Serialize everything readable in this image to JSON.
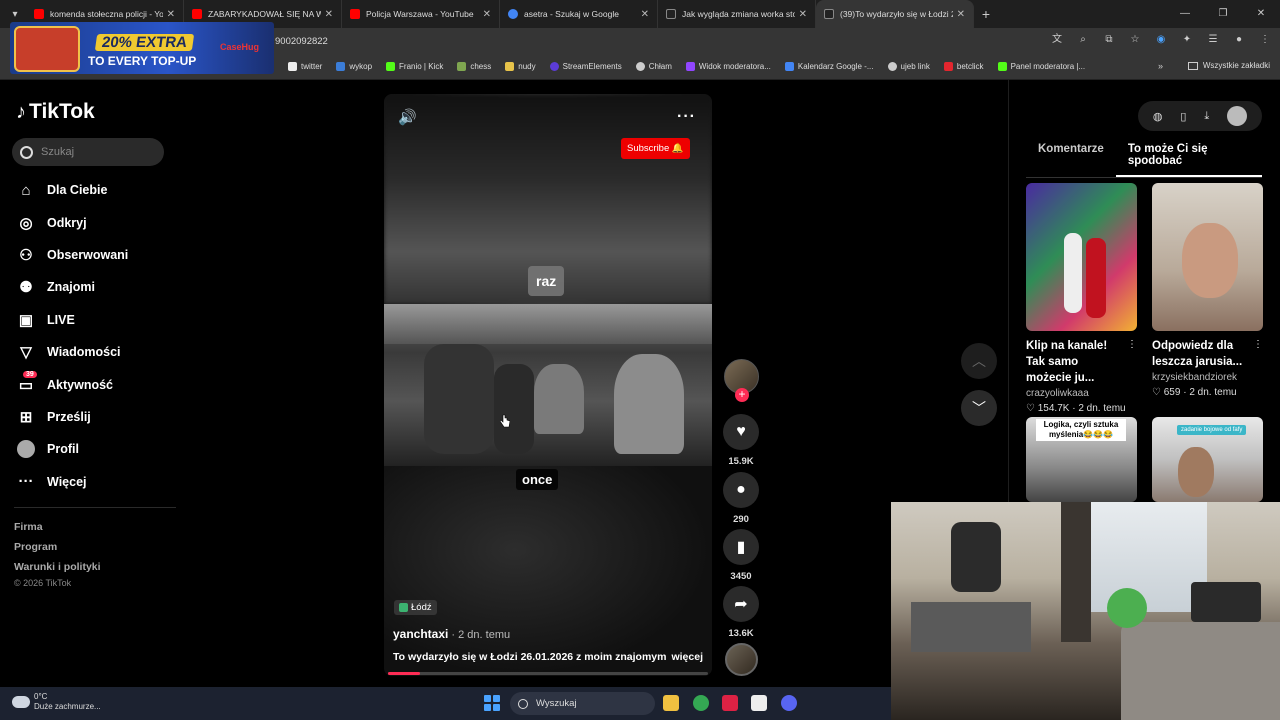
{
  "browser": {
    "tabs": [
      {
        "title": "komenda stołeczna policji - You",
        "favicon_color": "#ff0000"
      },
      {
        "title": "ZABARYKADOWAŁ SIĘ NA WAR",
        "favicon_color": "#ff0000"
      },
      {
        "title": "Policja Warszawa - YouTube",
        "favicon_color": "#ff0000"
      },
      {
        "title": "asetra - Szukaj w Google",
        "favicon_color": "#4285f4"
      },
      {
        "title": "Jak wygląda zmiana worka stom",
        "favicon_color": "#222222"
      },
      {
        "title": "(39)To wydarzyło się w Łodzi 26",
        "favicon_color": "#222222"
      }
    ],
    "url": "9002092822",
    "bookmarks": [
      {
        "label": "twitter",
        "color": "#eeeeee"
      },
      {
        "label": "wykop",
        "color": "#3b7dd8"
      },
      {
        "label": "Franio | Kick",
        "color": "#53fc18"
      },
      {
        "label": "chess",
        "color": "#7fa650"
      },
      {
        "label": "nudy",
        "color": "#e7c34a"
      },
      {
        "label": "StreamElements",
        "color": "#5c3cd6"
      },
      {
        "label": "Chłam",
        "color": "#cccccc"
      },
      {
        "label": "Widok moderatora...",
        "color": "#9146ff"
      },
      {
        "label": "Kalendarz Google -...",
        "color": "#4285f4"
      },
      {
        "label": "ujeb link",
        "color": "#cccccc"
      },
      {
        "label": "betclick",
        "color": "#e3262e"
      },
      {
        "label": "Panel moderatora |...",
        "color": "#53fc18"
      }
    ],
    "bookmarks_all": "Wszystkie zakładki"
  },
  "ad": {
    "headline": "20% EXTRA",
    "sub": "TO EVERY TOP-UP",
    "brand": "CaseHug"
  },
  "tiktok": {
    "logo": "TikTok",
    "search_placeholder": "Szukaj",
    "nav": [
      {
        "label": "Dla Ciebie",
        "icon": "home-icon"
      },
      {
        "label": "Odkryj",
        "icon": "compass-icon"
      },
      {
        "label": "Obserwowani",
        "icon": "following-icon"
      },
      {
        "label": "Znajomi",
        "icon": "friends-icon"
      },
      {
        "label": "LIVE",
        "icon": "live-icon"
      },
      {
        "label": "Wiadomości",
        "icon": "messages-icon"
      },
      {
        "label": "Aktywność",
        "icon": "activity-icon",
        "badge": "39"
      },
      {
        "label": "Prześlij",
        "icon": "upload-icon"
      },
      {
        "label": "Profil",
        "icon": "profile-icon"
      },
      {
        "label": "Więcej",
        "icon": "more-icon"
      }
    ],
    "footer": [
      "Firma",
      "Program",
      "Warunki i polityki"
    ],
    "copyright": "© 2026 TikTok"
  },
  "video": {
    "subscribe": "Subscribe",
    "caption_top": "raz",
    "caption_bottom": "once",
    "location": "Łódź",
    "author": "yanchtaxi",
    "ago": " · 2 dn. temu",
    "description": "To wydarzyło się w Łodzi 26.01.2026 z moim znajomym",
    "more": "więcej",
    "progress": 0.1,
    "likes": "15.9K",
    "comments": "290",
    "saves": "3450",
    "shares": "13.6K"
  },
  "right": {
    "tabs": [
      "Komentarze",
      "To może Ci się spodobać"
    ],
    "active_tab": 1,
    "cards": [
      {
        "title": "Klip na kanale! Tak samo możecie ju...",
        "user": "crazyoliwkaaa",
        "likes": "154.7K",
        "ago": "2 dn. temu"
      },
      {
        "title": "Odpowiedz dla leszcza jarusia...",
        "user": "krzysiekbandziorek",
        "likes": "659",
        "ago": "2 dn. temu"
      },
      {
        "thumb_label": "Logika, czyli sztuka myślenia😂😂😂"
      },
      {
        "thumb_label": "zadanie bojowe od fafy"
      }
    ]
  },
  "taskbar": {
    "temp": "0°C",
    "weather": "Duże zachmurze...",
    "search_placeholder": "Wyszukaj"
  }
}
